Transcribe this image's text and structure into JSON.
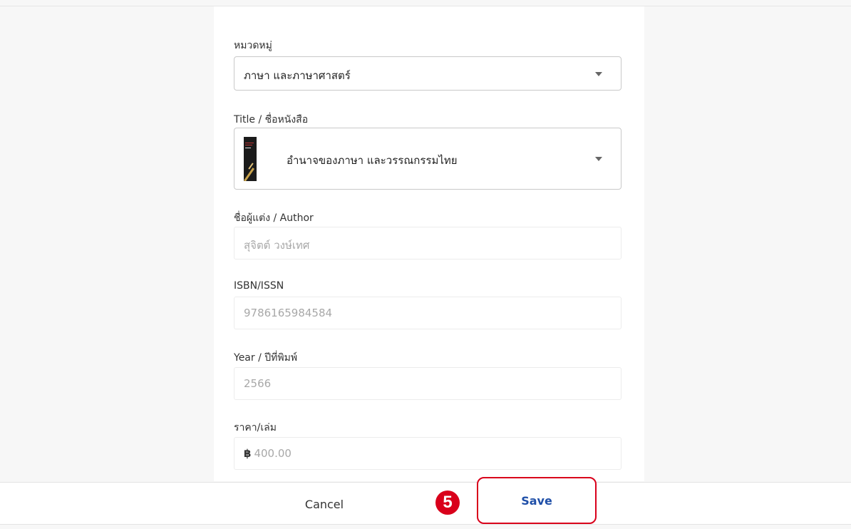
{
  "form": {
    "category": {
      "label": "หมวดหมู่",
      "value": "ภาษา และภาษาศาสตร์"
    },
    "title": {
      "label": "Title / ชื่อหนังสือ",
      "value": "อำนาจของภาษา และวรรณกรรมไทย"
    },
    "author": {
      "label": "ชื่อผู้แต่ง / Author",
      "placeholder": "สุจิตต์ วงษ์เทศ"
    },
    "isbn": {
      "label": "ISBN/ISSN",
      "placeholder": "9786165984584"
    },
    "year": {
      "label": "Year / ปีที่พิมพ์",
      "placeholder": "2566"
    },
    "price": {
      "label": "ราคา/เล่ม",
      "currency": "฿",
      "placeholder": "400.00"
    }
  },
  "footer": {
    "cancel_label": "Cancel",
    "step_number": "5",
    "save_label": "Save"
  },
  "colors": {
    "accent": "#1f4fa8",
    "highlight": "#d9001b"
  },
  "icons": {
    "dropdown": "caret-down-icon",
    "cover": "book-cover-thumbnail"
  }
}
